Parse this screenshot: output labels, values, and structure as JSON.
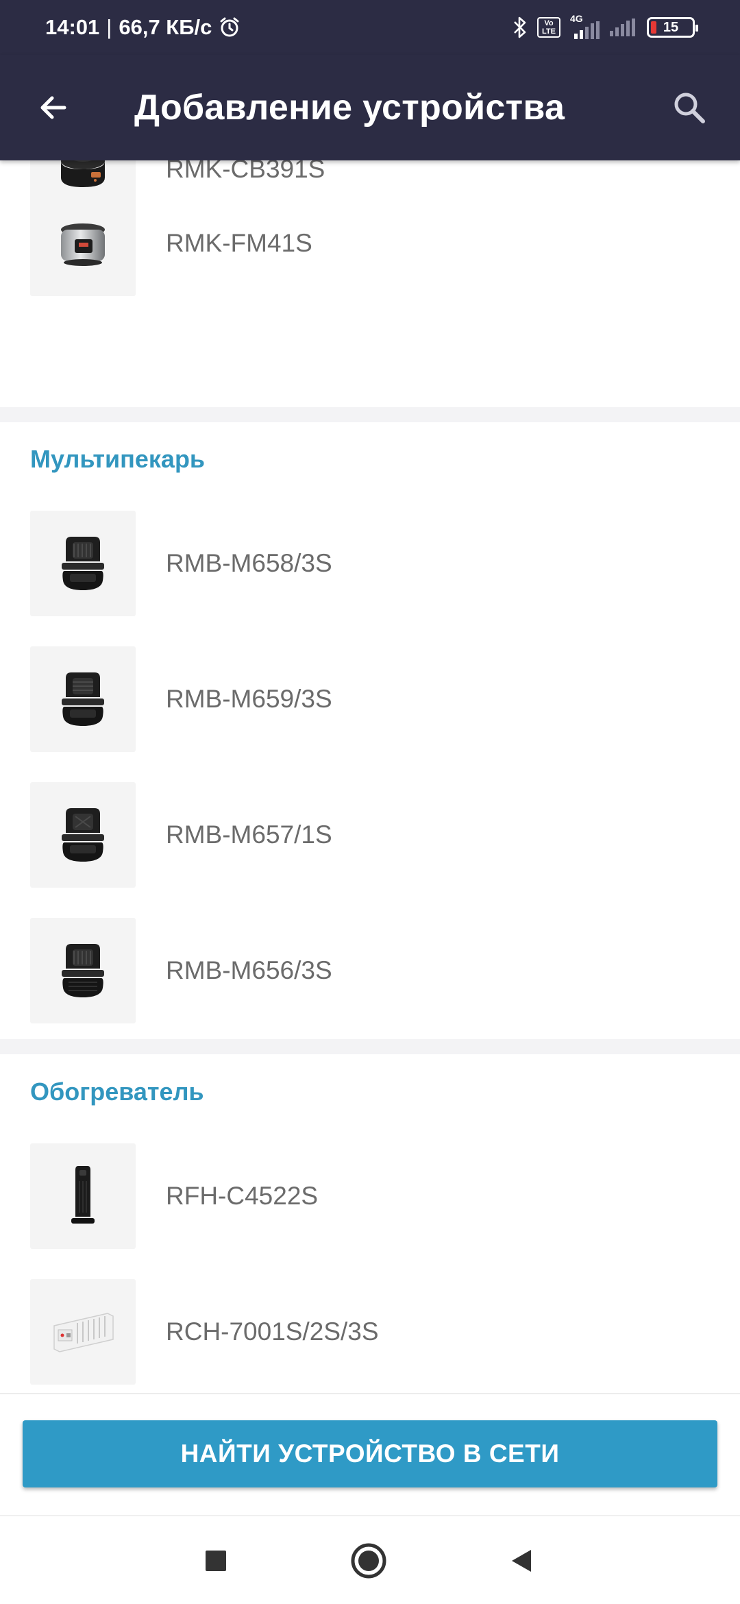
{
  "status_bar": {
    "time": "14:01",
    "separator": "|",
    "speed": "66,7 КБ/с",
    "network": "4G",
    "volte": "Vo LTE",
    "battery": "15"
  },
  "app_bar": {
    "title": "Добавление устройства"
  },
  "devices_top": [
    {
      "name": "RMK-CB391S",
      "icon": "multicooker-dark-icon"
    },
    {
      "name": "RMK-FM41S",
      "icon": "multicooker-steel-icon"
    }
  ],
  "sections": [
    {
      "title": "Мультипекарь",
      "items": [
        {
          "name": "RMB-M658/3S",
          "icon": "sandwich-maker-icon"
        },
        {
          "name": "RMB-M659/3S",
          "icon": "sandwich-maker-icon"
        },
        {
          "name": "RMB-M657/1S",
          "icon": "sandwich-maker-icon"
        },
        {
          "name": "RMB-M656/3S",
          "icon": "sandwich-maker-icon"
        }
      ]
    },
    {
      "title": "Обогреватель",
      "items": [
        {
          "name": "RFH-C4522S",
          "icon": "tower-heater-icon"
        },
        {
          "name": "RCH-7001S/2S/3S",
          "icon": "convector-heater-icon"
        }
      ]
    }
  ],
  "find_button": {
    "label": "НАЙТИ УСТРОЙСТВО В СЕТИ"
  },
  "colors": {
    "app_bar": "#2c2c44",
    "accent": "#2f9ac6",
    "section_title": "#3296bf",
    "item_text": "#6b6b6b"
  }
}
